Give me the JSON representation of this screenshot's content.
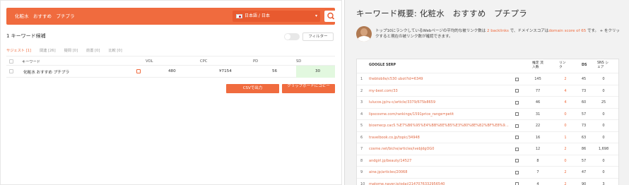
{
  "search": {
    "query": "化粧水　おすすめ　プチプラ",
    "location": "日本語 / 日本"
  },
  "keywords_panel": {
    "count_label": "1 キーワード候補",
    "filter_label": "フィルター",
    "tabs": [
      {
        "label": "サジェスト [1]"
      },
      {
        "label": "関連 [26]"
      },
      {
        "label": "疑問 [0]"
      },
      {
        "label": "前置 [0]"
      },
      {
        "label": "比較 [0]"
      }
    ],
    "columns": {
      "keyword": "キーワード",
      "vol": "VOL",
      "cpc": "CPC",
      "pd": "PD",
      "sd": "SD"
    },
    "rows": [
      {
        "keyword": "化粧水 おすすめ プチプラ",
        "vol": "480",
        "cpc": "¥7154",
        "pd": "56",
        "sd": "30"
      }
    ],
    "csv_button": "CSVで出力",
    "clipboard_button": "クリップボードにコピー"
  },
  "overview": {
    "title": "キーワード概要: 化粧水　おすすめ　プチプラ",
    "info_pre": "トップ10にランクしているWebページの平均的な被リンク数は ",
    "info_backlinks": "2 backlinks",
    "info_mid": " で、ドメインスコアは",
    "info_score": "domain score of 65",
    "info_post": " です。 + をクリックすると現在の被リンク数が確認できます。",
    "serp_columns": {
      "serp": "GOOGLE SERP",
      "est": "推定 流入数",
      "links": "リンク",
      "ds": "DS",
      "sns": "SNS シェア"
    },
    "serp_rows": [
      {
        "rank": "1",
        "url": "thebtoblle/c530 ubot?id=6349",
        "est": "145",
        "links": "2",
        "ds": "45",
        "sns": "0"
      },
      {
        "rank": "2",
        "url": "my-best.com/33",
        "est": "77",
        "links": "4",
        "ds": "73",
        "sns": "0"
      },
      {
        "rank": "3",
        "url": "lulucos.jp/ru-c/article/3379/675b8659",
        "est": "46",
        "links": "4",
        "ds": "60",
        "sns": "25"
      },
      {
        "rank": "4",
        "url": "lipscosme.com/rankings/1591price_range=petit",
        "est": "31",
        "links": "0",
        "ds": "57",
        "sns": "0"
      },
      {
        "rank": "5",
        "url": "biosmecp.cac5.%E7%B6%95%E4%BB%BE%B5%E3%80%8E%B2%BF%E8%91%8E",
        "est": "22",
        "links": "0",
        "ds": "73",
        "sns": "0"
      },
      {
        "rank": "6",
        "url": "travelbook.co.jp/topic/34948",
        "est": "16",
        "links": "1",
        "ds": "63",
        "sns": "0"
      },
      {
        "rank": "7",
        "url": "cosme.net/biche/articles/ivebJdgOG0",
        "est": "12",
        "links": "2",
        "ds": "86",
        "sns": "1,698"
      },
      {
        "rank": "8",
        "url": "andgirl.jp/beauty/14527",
        "est": "8",
        "links": "0",
        "ds": "57",
        "sns": "0"
      },
      {
        "rank": "9",
        "url": "aine.jp/articles/20068",
        "est": "7",
        "links": "2",
        "ds": "47",
        "sns": "0"
      },
      {
        "rank": "10",
        "url": "matome.naver.jp/odai/2147076332956540",
        "est": "4",
        "links": "2",
        "ds": "90",
        "sns": "3"
      }
    ]
  }
}
